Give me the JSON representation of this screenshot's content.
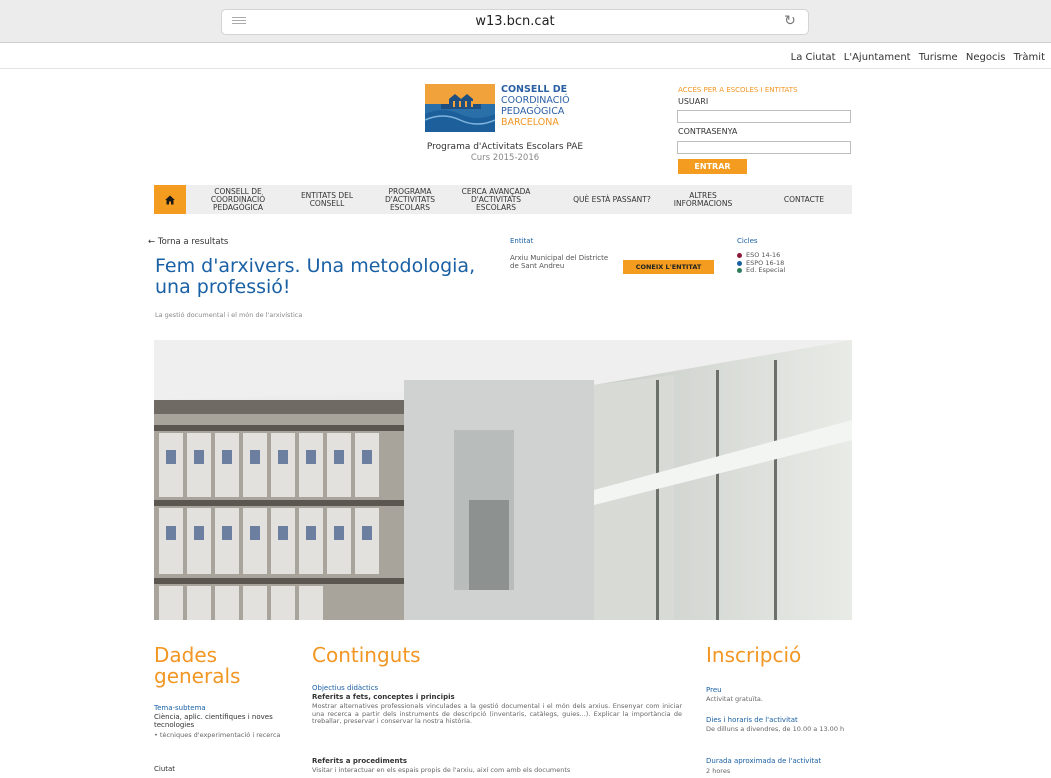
{
  "browser": {
    "url": "w13.bcn.cat"
  },
  "top_links": [
    "La Ciutat",
    "L'Ajuntament",
    "Turisme",
    "Negocis",
    "Tràmit"
  ],
  "logo": {
    "line1": "CONSELL DE",
    "line2": "COORDINACIÓ",
    "line3": "PEDAGÒGICA",
    "line4": "BARCELONA"
  },
  "program": {
    "title": "Programa d'Activitats Escolars PAE",
    "course": "Curs 2015-2016"
  },
  "login": {
    "title": "ACCÉS PER A ESCOLES I ENTITATS",
    "user_label": "USUARI",
    "password_label": "CONTRASENYA",
    "submit": "ENTRAR"
  },
  "nav": {
    "items": [
      {
        "line1": "CONSELL DE",
        "line2": "COORDINACIÓ",
        "line3": "PEDAGÒGICA"
      },
      {
        "line1": "ENTITATS DEL",
        "line2": "CONSELL",
        "line3": ""
      },
      {
        "line1": "PROGRAMA",
        "line2": "D'ACTIVITATS",
        "line3": "ESCOLARS"
      },
      {
        "line1": "CERCA AVANÇADA",
        "line2": "D'ACTIVITATS",
        "line3": "ESCOLARS"
      },
      {
        "line1": "QUÈ ESTÀ PASSANT?",
        "line2": "",
        "line3": ""
      },
      {
        "line1": "ALTRES",
        "line2": "INFORMACIONS",
        "line3": ""
      },
      {
        "line1": "CONTACTE",
        "line2": "",
        "line3": ""
      }
    ]
  },
  "activity": {
    "back": "← Torna a resultats",
    "title": "Fem d'arxivers. Una metodologia, una professió!",
    "subtitle": "La gestió documental i el món de l'arxivística",
    "entity_label": "Entitat",
    "entity_name": "Arxiu Municipal del Districte de Sant Andreu",
    "entity_button": "CONEIX L'ENTITAT",
    "cycles_label": "Cicles",
    "cycles": [
      {
        "name": "ESO 14-16",
        "color": "#8b1a3a"
      },
      {
        "name": "ESPO 16-18",
        "color": "#1a60a4"
      },
      {
        "name": "Ed. Especial",
        "color": "#2f7d5a"
      }
    ]
  },
  "general": {
    "title_line1": "Dades",
    "title_line2": "generals",
    "subtheme_label": "Tema-subtema",
    "subtheme_value": "Ciència, aplic. científiques i noves tecnologies",
    "subtheme_item": "tècniques d'experimentació i recerca",
    "city_label": "Ciutat"
  },
  "contents": {
    "title": "Continguts",
    "objectives_label": "Objectius didàctics",
    "facts_heading": "Referits a fets, conceptes i principis",
    "facts_text": "Mostrar alternatives professionals vinculades a la gestió documental i el món dels arxius. Ensenyar com iniciar una recerca a partir dels instruments de descripció (inventaris, catàlegs, guies...). Explicar la importància de treballar, preservar i conservar la nostra història.",
    "procedures_heading": "Referits a procediments",
    "procedures_text": "Visitar i interactuar en els espais propis de l'arxiu, així com amb els documents"
  },
  "registration": {
    "title": "Inscripció",
    "price_label": "Preu",
    "price_value": "Activitat gratuïta.",
    "schedule_label": "Dies i horaris de l'activitat",
    "schedule_value": "De dilluns a divendres, de 10.00 a 13.00 h",
    "duration_label": "Durada aproximada de l'activitat",
    "duration_value": "2 hores"
  }
}
